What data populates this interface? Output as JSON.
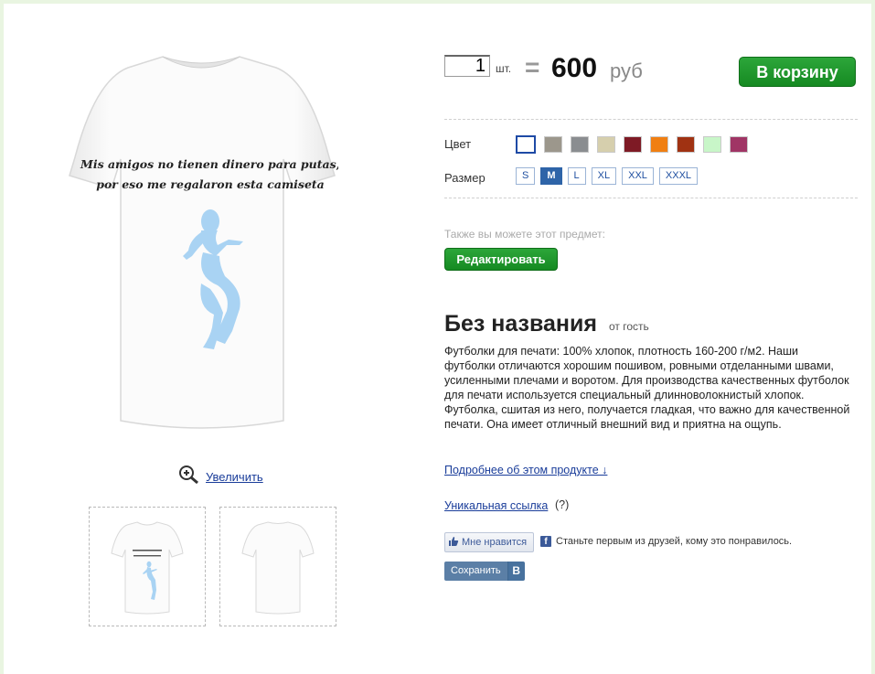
{
  "product": {
    "shirt_print_line1": "Mis amigos no tienen dinero para putas,",
    "shirt_print_line2": "por eso me regalaron esta camiseta",
    "zoom_label": "Увеличить"
  },
  "purchase": {
    "quantity": "1",
    "unit": "шт.",
    "equals": "=",
    "price": "600",
    "currency": "руб",
    "cart_button": "В корзину"
  },
  "options": {
    "color_label": "Цвет",
    "colors": [
      "#ffffff",
      "#9c978c",
      "#8a8d90",
      "#d6cfad",
      "#7e1a25",
      "#f07f12",
      "#a03212",
      "#c8f6c8",
      "#a03565"
    ],
    "size_label": "Размер",
    "sizes": [
      "S",
      "M",
      "L",
      "XL",
      "XXL",
      "XXXL"
    ],
    "selected_size": "M"
  },
  "edit": {
    "also_text": "Также вы можете этот предмет:",
    "edit_button": "Редактировать"
  },
  "info": {
    "title": "Без названия",
    "author": "от гость",
    "description": "Футболки для печати: 100% хлопок, плотность 160-200 г/м2. Наши футболки отличаются хорошим пошивом, ровными отделанными швами, усиленными плечами и воротом. Для производства качественных футболок для печати используется специальный длинноволокнистый хлопок. Футболка, сшитая из него, получается гладкая, что важно для качественной печати. Она имеет отличный внешний вид и приятна на ощупь.",
    "more_link": "Подробнее об этом продукте ↓",
    "unique_link": "Уникальная ссылка",
    "help": "(?)"
  },
  "social": {
    "like_label": "Мне нравится",
    "fb_text": "Станьте первым из друзей, кому это понравилось.",
    "fb_logo": "f",
    "vk_save": "Сохранить",
    "vk_logo": "B"
  }
}
